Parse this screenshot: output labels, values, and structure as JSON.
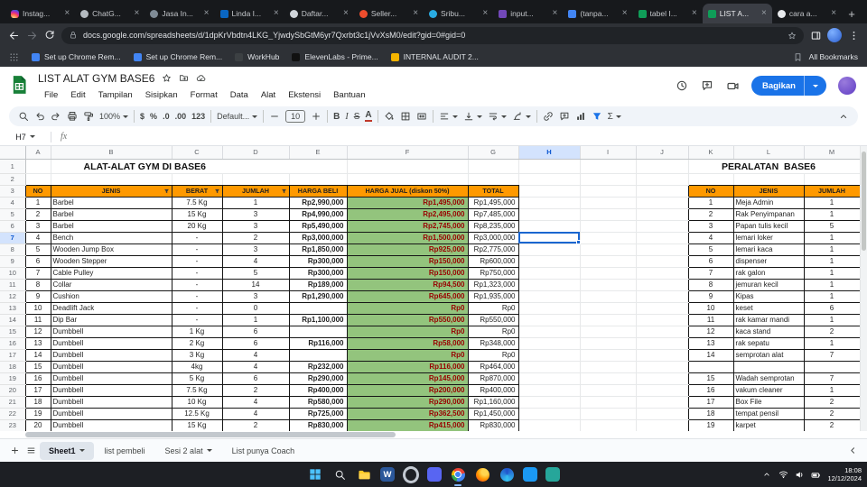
{
  "browser": {
    "tabs": [
      {
        "title": "Instag...",
        "favicon": "instagram",
        "color": "#d6249f"
      },
      {
        "title": "ChatG...",
        "favicon": "chatgpt",
        "color": "#b4bac0"
      },
      {
        "title": "Jasa In...",
        "favicon": "generic",
        "color": "#7f8b96"
      },
      {
        "title": "Linda I...",
        "favicon": "linkedin",
        "color": "#0a66c2"
      },
      {
        "title": "Daftar...",
        "favicon": "generic",
        "color": "#cfd4d9"
      },
      {
        "title": "Seller...",
        "favicon": "shopee",
        "color": "#ee4d2d"
      },
      {
        "title": "Sribu...",
        "favicon": "sribu",
        "color": "#29abe2"
      },
      {
        "title": "input...",
        "favicon": "forms",
        "color": "#7248b9"
      },
      {
        "title": "(tanpa...",
        "favicon": "docs",
        "color": "#4285f4"
      },
      {
        "title": "tabel I...",
        "favicon": "sheets",
        "color": "#0f9d58"
      },
      {
        "title": "LIST A...",
        "favicon": "sheets",
        "color": "#0f9d58",
        "active": true
      },
      {
        "title": "cara a...",
        "favicon": "generic",
        "color": "#e8eaed"
      }
    ],
    "url": "docs.google.com/spreadsheets/d/1dpKrVbdtn4LKG_YjwdySbGtM6yr7Qxrbt3c1jVvXsM0/edit?gid=0#gid=0",
    "bookmarks": [
      {
        "label": "Set up Chrome Rem...",
        "color": "#4285f4"
      },
      {
        "label": "Set up Chrome Rem...",
        "color": "#4285f4"
      },
      {
        "label": "WorkHub",
        "color": "#3c4043"
      },
      {
        "label": "ElevenLabs - Prime...",
        "color": "#111111"
      },
      {
        "label": "INTERNAL AUDIT 2...",
        "color": "#f4b400"
      }
    ],
    "all_bookmarks_label": "All Bookmarks"
  },
  "app": {
    "doc_title": "LIST ALAT GYM BASE6",
    "accent": "#1a73e8",
    "menus": [
      "File",
      "Edit",
      "Tampilan",
      "Sisipkan",
      "Format",
      "Data",
      "Alat",
      "Ekstensi",
      "Bantuan"
    ],
    "share_label": "Bagikan",
    "name_box": "H7",
    "fx_label": "fx",
    "toolbar_items": [
      {
        "icon": "search",
        "name": "toolbar-search"
      },
      {
        "icon": "undo",
        "name": "undo"
      },
      {
        "icon": "redo",
        "name": "redo"
      },
      {
        "icon": "print",
        "name": "print"
      },
      {
        "icon": "roller",
        "name": "paint-format"
      },
      {
        "label": "100%",
        "caret": true,
        "name": "zoom-select"
      },
      {
        "sep": true
      },
      {
        "label": "$",
        "cls": "sym",
        "name": "format-as-currency"
      },
      {
        "label": "%",
        "cls": "sym",
        "name": "format-as-percent"
      },
      {
        "label": ".0",
        "cls": "sym",
        "name": "decrease-decimal-places"
      },
      {
        "label": ".00",
        "cls": "sym",
        "name": "increase-decimal-places"
      },
      {
        "label": "123",
        "cls": "sym",
        "name": "more-number-formats"
      },
      {
        "sep": true
      },
      {
        "label": "Default...",
        "caret": true,
        "name": "font-family-select"
      },
      {
        "sep": true
      },
      {
        "icon": "minus",
        "name": "decrease-font-size"
      },
      {
        "label": "10",
        "box": true,
        "name": "font-size-input"
      },
      {
        "icon": "plus",
        "name": "increase-font-size"
      },
      {
        "sep": true
      },
      {
        "label": "B",
        "cls": "b",
        "name": "bold"
      },
      {
        "label": "I",
        "cls": "i",
        "name": "italic"
      },
      {
        "label": "S",
        "cls": "s",
        "name": "strikethrough"
      },
      {
        "label": "A",
        "cls": "a",
        "name": "text-color"
      },
      {
        "sep": true
      },
      {
        "icon": "fill",
        "name": "fill-color"
      },
      {
        "icon": "borders",
        "name": "borders"
      },
      {
        "icon": "merge",
        "name": "merge-cells"
      },
      {
        "sep": true
      },
      {
        "icon": "alignleft",
        "caret": true,
        "name": "horizontal-align"
      },
      {
        "icon": "valign",
        "caret": true,
        "name": "vertical-align"
      },
      {
        "icon": "wrap",
        "caret": true,
        "name": "text-wrapping"
      },
      {
        "icon": "rotate",
        "caret": true,
        "name": "text-rotation"
      },
      {
        "sep": true
      },
      {
        "icon": "link",
        "name": "insert-link"
      },
      {
        "icon": "comment",
        "name": "insert-comment"
      },
      {
        "icon": "chart",
        "name": "insert-chart"
      },
      {
        "icon": "filter",
        "active": true,
        "name": "create-filter"
      },
      {
        "icon": "sigmaT",
        "caret": true,
        "name": "functions"
      },
      {
        "icon": "collapse",
        "right": true,
        "name": "collapse-toolbar"
      }
    ],
    "sheet_tabs": [
      {
        "label": "Sheet1",
        "active": true,
        "caret": true
      },
      {
        "label": "list pembeli"
      },
      {
        "label": "Sesi 2 alat",
        "caret": true
      },
      {
        "label": "List punya Coach"
      }
    ]
  },
  "grid": {
    "column_letters": [
      "A",
      "B",
      "C",
      "D",
      "E",
      "F",
      "G",
      "H",
      "I",
      "J",
      "K",
      "L",
      "M"
    ],
    "selected_cell": {
      "col": "H",
      "row": 7,
      "label": "H7"
    },
    "title_left": "ALAT-ALAT GYM DI BASE6",
    "title_right": "PERALATAN  BASE6",
    "colors": {
      "header_bg": "#ff9900",
      "sale_bg": "#93c47d",
      "sale_text": "#990000",
      "selection": "#1a66d0"
    },
    "gym_table": {
      "headers": [
        "NO",
        "JENIS",
        "BERAT",
        "JUMLAH",
        "HARGA BELI",
        "HARGA JUAL (diskon 50%)",
        "TOTAL"
      ],
      "rows": [
        [
          "1",
          "Barbel",
          "7.5 Kg",
          "1",
          "Rp2,990,000",
          "Rp1,495,000",
          "Rp1,495,000"
        ],
        [
          "2",
          "Barbel",
          "15 Kg",
          "3",
          "Rp4,990,000",
          "Rp2,495,000",
          "Rp7,485,000"
        ],
        [
          "3",
          "Barbel",
          "20 Kg",
          "3",
          "Rp5,490,000",
          "Rp2,745,000",
          "Rp8,235,000"
        ],
        [
          "4",
          "Bench",
          "-",
          "2",
          "Rp3,000,000",
          "Rp1,500,000",
          "Rp3,000,000"
        ],
        [
          "5",
          "Wooden Jump Box",
          "-",
          "3",
          "Rp1,850,000",
          "Rp925,000",
          "Rp2,775,000"
        ],
        [
          "6",
          "Wooden Stepper",
          "-",
          "4",
          "Rp300,000",
          "Rp150,000",
          "Rp600,000"
        ],
        [
          "7",
          "Cable Pulley",
          "-",
          "5",
          "Rp300,000",
          "Rp150,000",
          "Rp750,000"
        ],
        [
          "8",
          "Collar",
          "-",
          "14",
          "Rp189,000",
          "Rp94,500",
          "Rp1,323,000"
        ],
        [
          "9",
          "Cushion",
          "-",
          "3",
          "Rp1,290,000",
          "Rp645,000",
          "Rp1,935,000"
        ],
        [
          "10",
          "Deadlift Jack",
          "-",
          "0",
          "",
          "Rp0",
          "Rp0"
        ],
        [
          "11",
          "Dip Bar",
          "-",
          "1",
          "Rp1,100,000",
          "Rp550,000",
          "Rp550,000"
        ],
        [
          "12",
          "Dumbbell",
          "1 Kg",
          "6",
          "",
          "Rp0",
          "Rp0"
        ],
        [
          "13",
          "Dumbbell",
          "2 Kg",
          "6",
          "Rp116,000",
          "Rp58,000",
          "Rp348,000"
        ],
        [
          "14",
          "Dumbbell",
          "3 Kg",
          "4",
          "",
          "Rp0",
          "Rp0"
        ],
        [
          "15",
          "Dumbbell",
          "4kg",
          "4",
          "Rp232,000",
          "Rp116,000",
          "Rp464,000"
        ],
        [
          "16",
          "Dumbbell",
          "5 Kg",
          "6",
          "Rp290,000",
          "Rp145,000",
          "Rp870,000"
        ],
        [
          "17",
          "Dumbbell",
          "7.5 Kg",
          "2",
          "Rp400,000",
          "Rp200,000",
          "Rp400,000"
        ],
        [
          "18",
          "Dumbbell",
          "10 Kg",
          "4",
          "Rp580,000",
          "Rp290,000",
          "Rp1,160,000"
        ],
        [
          "19",
          "Dumbbell",
          "12.5 Kg",
          "4",
          "Rp725,000",
          "Rp362,500",
          "Rp1,450,000"
        ],
        [
          "20",
          "Dumbbell",
          "15 Kg",
          "2",
          "Rp830,000",
          "Rp415,000",
          "Rp830,000"
        ]
      ]
    },
    "equipment_table": {
      "headers": [
        "NO",
        "JENIS",
        "JUMLAH"
      ],
      "rows": [
        [
          "1",
          "Meja Admin",
          "1"
        ],
        [
          "2",
          "Rak Penyimpanan",
          "1"
        ],
        [
          "3",
          "Papan tulis kecil",
          "5"
        ],
        [
          "4",
          "lemari loker",
          "1"
        ],
        [
          "5",
          "lemari kaca",
          "1"
        ],
        [
          "6",
          "dispenser",
          "1"
        ],
        [
          "7",
          "rak galon",
          "1"
        ],
        [
          "8",
          "jemuran kecil",
          "1"
        ],
        [
          "9",
          "Kipas",
          "1"
        ],
        [
          "10",
          "keset",
          "6"
        ],
        [
          "11",
          "rak kamar mandi",
          "1"
        ],
        [
          "12",
          "kaca stand",
          "2"
        ],
        [
          "13",
          "rak sepatu",
          "1"
        ],
        [
          "14",
          "semprotan alat",
          "7"
        ],
        null,
        [
          "15",
          "Wadah semprotan",
          "7"
        ],
        [
          "16",
          "vakum cleaner",
          "1"
        ],
        [
          "17",
          "Box File",
          "2"
        ],
        [
          "18",
          "tempat pensil",
          "2"
        ],
        [
          "19",
          "karpet",
          "2"
        ]
      ]
    }
  },
  "taskbar": {
    "time": "18:08",
    "date": "12/12/2024",
    "apps": [
      {
        "name": "start",
        "kind": "start"
      },
      {
        "name": "search",
        "kind": "search"
      },
      {
        "name": "file-explorer",
        "kind": "folder"
      },
      {
        "name": "word",
        "kind": "letter",
        "letter": "W",
        "color": "#2b579a"
      },
      {
        "name": "settings",
        "kind": "donut"
      },
      {
        "name": "discord",
        "kind": "square",
        "color": "#5865f2"
      },
      {
        "name": "chrome",
        "kind": "chrome",
        "open": true
      },
      {
        "name": "firefox",
        "kind": "firefox"
      },
      {
        "name": "edge",
        "kind": "edge"
      },
      {
        "name": "vscode",
        "kind": "square",
        "color": "#1b99f3"
      },
      {
        "name": "teams",
        "kind": "square",
        "color": "#26a69a"
      }
    ]
  }
}
